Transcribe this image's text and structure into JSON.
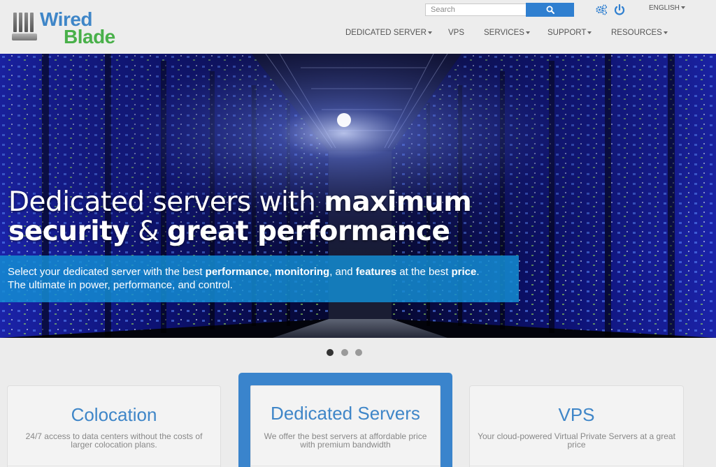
{
  "brand": {
    "line1": "Wired",
    "line2": "Blade"
  },
  "search": {
    "placeholder": "Search"
  },
  "top_icons": [
    "gears-icon",
    "power-icon"
  ],
  "language": {
    "label": "ENGLISH"
  },
  "nav": [
    {
      "label": "DEDICATED SERVER",
      "dropdown": true
    },
    {
      "label": "VPS",
      "dropdown": false
    },
    {
      "label": "SERVICES",
      "dropdown": true
    },
    {
      "label": "SUPPORT",
      "dropdown": true
    },
    {
      "label": "RESOURCES",
      "dropdown": true
    }
  ],
  "hero": {
    "headline": {
      "line1_light": "Dedicated servers with ",
      "line1_bold": "maximum",
      "line2_bold_a": "security",
      "line2_light": " & ",
      "line2_bold_b": "great performance"
    },
    "banner": {
      "line1_parts": [
        {
          "text": "Select your dedicated server with the best ",
          "bold": false
        },
        {
          "text": "performance",
          "bold": true
        },
        {
          "text": ", ",
          "bold": false
        },
        {
          "text": "monitoring",
          "bold": true
        },
        {
          "text": ", and ",
          "bold": false
        },
        {
          "text": "features",
          "bold": true
        },
        {
          "text": " at the best ",
          "bold": false
        },
        {
          "text": "price",
          "bold": true
        },
        {
          "text": ".",
          "bold": false
        }
      ],
      "line2": "The ultimate in power, performance, and control."
    }
  },
  "carousel": {
    "slide_count": 3,
    "active_index": 0
  },
  "cards": [
    {
      "title": "Colocation",
      "desc_line1": "24/7 access to data centers without the costs of",
      "desc_line2": "larger colocation plans.",
      "featured": false
    },
    {
      "title": "Dedicated Servers",
      "desc_line1": "We offer the best servers at affordable price",
      "desc_line2": "with premium bandwidth",
      "featured": true
    },
    {
      "title": "VPS",
      "desc_line1": "Your cloud-powered Virtual Private Servers at a great",
      "desc_line2": "price",
      "featured": false
    }
  ],
  "colors": {
    "brand_blue": "#3f86c8",
    "brand_green": "#49b04a",
    "search_button": "#2f7fd0",
    "banner": "#148cd2"
  }
}
